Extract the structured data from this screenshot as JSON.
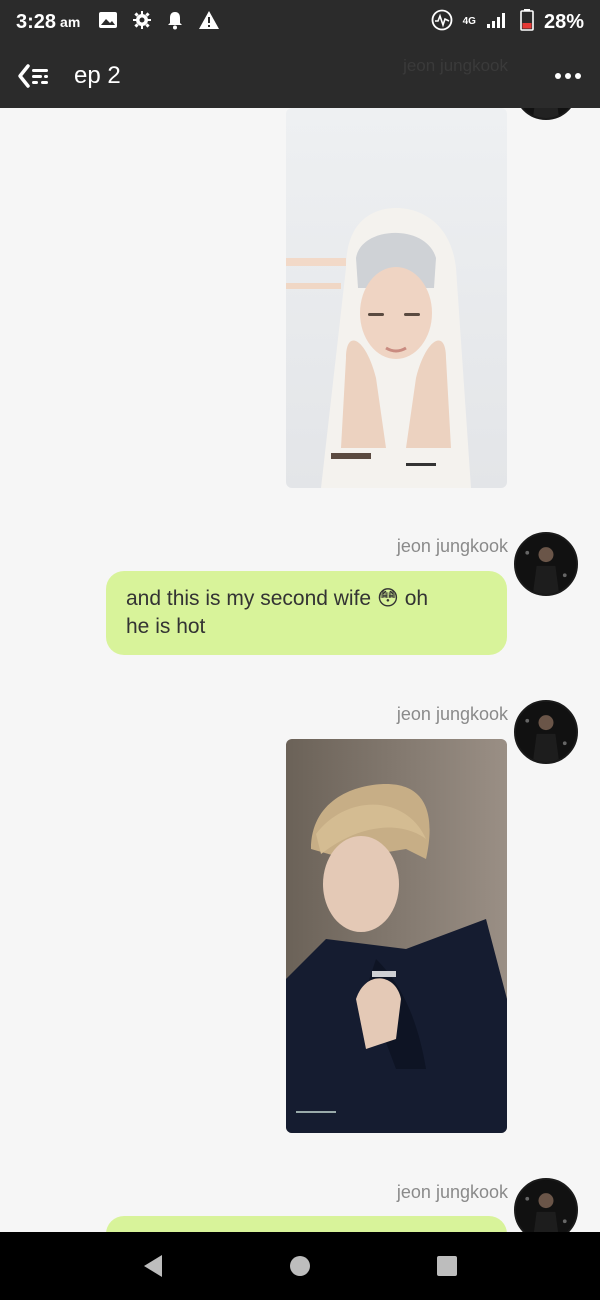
{
  "status": {
    "time": "3:28",
    "ampm": "am",
    "network": "4G",
    "battery": "28%"
  },
  "appbar": {
    "title": "ep 2",
    "ghost_sender": "jeon jungkook"
  },
  "messages": [
    {
      "type": "image",
      "sender": "",
      "desc": "photo-1"
    },
    {
      "type": "text",
      "sender": "jeon jungkook",
      "text_a": "and this is my second wife",
      "emoji": "😳",
      "text_b": "oh",
      "text_c": "he is hot"
    },
    {
      "type": "image",
      "sender": "jeon jungkook",
      "desc": "photo-2"
    },
    {
      "type": "text",
      "sender": "jeon jungkook",
      "text": ""
    }
  ],
  "icons": {
    "back": "back-drawer-icon",
    "more": "more-icon",
    "gallery": "image-icon",
    "settings": "gear-icon",
    "notification": "bell-icon",
    "warning": "warning-icon",
    "signal": "signal-icon",
    "battery": "battery-icon"
  },
  "colors": {
    "bar": "#2b2b2b",
    "bubble": "#d8f39a",
    "background": "#f6f6f6"
  }
}
